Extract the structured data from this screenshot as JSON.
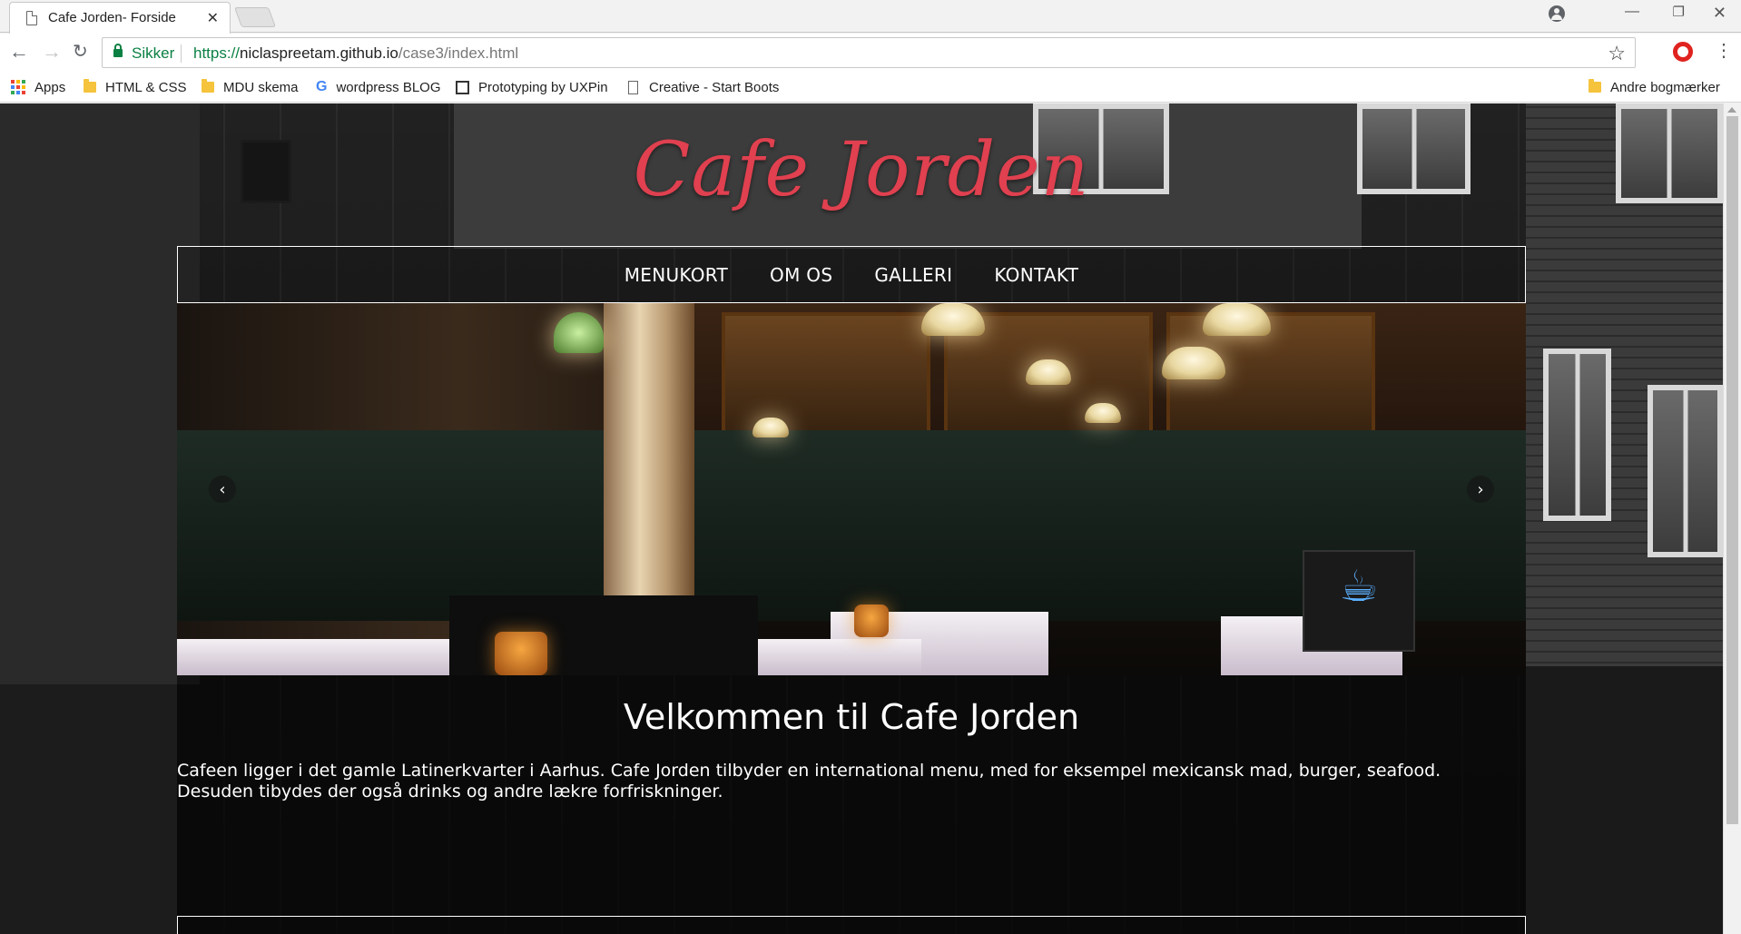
{
  "browser": {
    "tab_title": "Cafe Jorden- Forside",
    "secure_label": "Sikker",
    "url_scheme": "https://",
    "url_host": "niclaspreetam.github.io",
    "url_path": "/case3/index.html"
  },
  "bookmarks": {
    "items": [
      {
        "label": "Apps"
      },
      {
        "label": "HTML & CSS"
      },
      {
        "label": "MDU skema"
      },
      {
        "label": "wordpress BLOG"
      },
      {
        "label": "Prototyping by UXPin"
      },
      {
        "label": "Creative - Start Boots"
      }
    ],
    "other_label": "Andre bogmærker"
  },
  "site": {
    "logo": "Cafe Jorden",
    "nav": [
      "MENUKORT",
      "OM OS",
      "GALLERI",
      "KONTAKT"
    ],
    "welcome_heading": "Velkommen til Cafe Jorden",
    "intro_line1": "Cafeen ligger i det gamle Latinerkvarter i Aarhus. Cafe Jorden tilbyder en international menu, med for eksempel mexicansk mad, burger, seafood.",
    "intro_line2": "Desuden tibydes der også drinks og andre lækre forfriskninger.",
    "logo_color": "#e0404f"
  },
  "icons": {
    "carousel_prev": "chevron-left-icon",
    "carousel_next": "chevron-right-icon"
  }
}
